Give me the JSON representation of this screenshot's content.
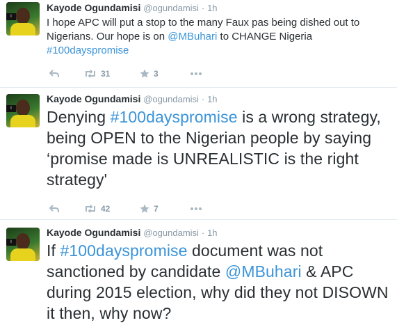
{
  "tweets": [
    {
      "name": "Kayode Ogundamisi",
      "handle": "@ogundamisi",
      "separator": "·",
      "time": "1h",
      "text": [
        {
          "t": "I hope  APC will put a stop to the many Faux pas being dished out to Nigerians. Our hope is on ",
          "link": false
        },
        {
          "t": "@MBuhari",
          "link": true
        },
        {
          "t": " to CHANGE Nigeria ",
          "link": false
        },
        {
          "t": "#100dayspromise",
          "link": true
        }
      ],
      "retweets": "31",
      "favorites": "3"
    },
    {
      "name": "Kayode Ogundamisi",
      "handle": "@ogundamisi",
      "separator": "·",
      "time": "1h",
      "text": [
        {
          "t": "Denying ",
          "link": false
        },
        {
          "t": "#100dayspromise",
          "link": true
        },
        {
          "t": " is a wrong strategy, being OPEN to the Nigerian people by saying ‘promise made is UNREALISTIC is the right strategy'",
          "link": false
        }
      ],
      "retweets": "42",
      "favorites": "7"
    },
    {
      "name": "Kayode Ogundamisi",
      "handle": "@ogundamisi",
      "separator": "·",
      "time": "1h",
      "text": [
        {
          "t": "If ",
          "link": false
        },
        {
          "t": "#100dayspromise",
          "link": true
        },
        {
          "t": " document was not sanctioned by candidate ",
          "link": false
        },
        {
          "t": "@MBuhari",
          "link": true
        },
        {
          "t": " & APC during 2015 election, why did they not DISOWN it then, why now?",
          "link": false
        }
      ],
      "retweets": "",
      "favorites": ""
    }
  ],
  "icons": {
    "reply": "reply-icon",
    "retweet": "retweet-icon",
    "favorite": "star-icon",
    "more": "more-icon"
  },
  "colors": {
    "link": "#3b94d9",
    "muted": "#8899a6",
    "text": "#292f33",
    "divider": "#e1e8ed"
  }
}
